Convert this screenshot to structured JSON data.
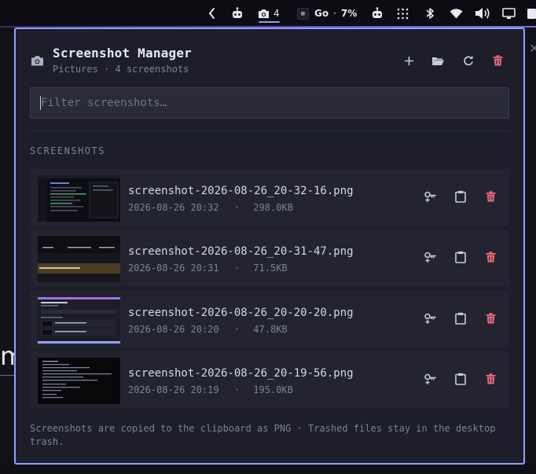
{
  "topbar": {
    "screenshot_count": "4",
    "go_label": "Go",
    "percent": "7%",
    "separator": "·"
  },
  "background": {
    "partial_letter": "m"
  },
  "panel": {
    "title": "Screenshot Manager",
    "subtitle": "Pictures · 4 screenshots",
    "filter_placeholder": "Filter screenshots…",
    "filter_value": "",
    "section_label": "SCREENSHOTS",
    "footer": "Screenshots are copied to the clipboard as PNG · Trashed files stay in the desktop trash.",
    "colors": {
      "accent": "#8ea2ff",
      "delete": "#f0687a",
      "panel": "#1d1e29"
    },
    "icons": [
      "camera-icon",
      "plus-icon",
      "folder-open-icon",
      "refresh-icon",
      "trash-icon",
      "key-icon",
      "clipboard-icon"
    ]
  },
  "screenshots": [
    {
      "filename": "screenshot-2026-08-26_20-32-16.png",
      "datetime": "2026-08-26 20:32",
      "separator": "·",
      "size": "298.0KB"
    },
    {
      "filename": "screenshot-2026-08-26_20-31-47.png",
      "datetime": "2026-08-26 20:31",
      "separator": "·",
      "size": "71.5KB"
    },
    {
      "filename": "screenshot-2026-08-26_20-20-20.png",
      "datetime": "2026-08-26 20:20",
      "separator": "·",
      "size": "47.8KB"
    },
    {
      "filename": "screenshot-2026-08-26_20-19-56.png",
      "datetime": "2026-08-26 20:19",
      "separator": "·",
      "size": "195.0KB"
    }
  ]
}
